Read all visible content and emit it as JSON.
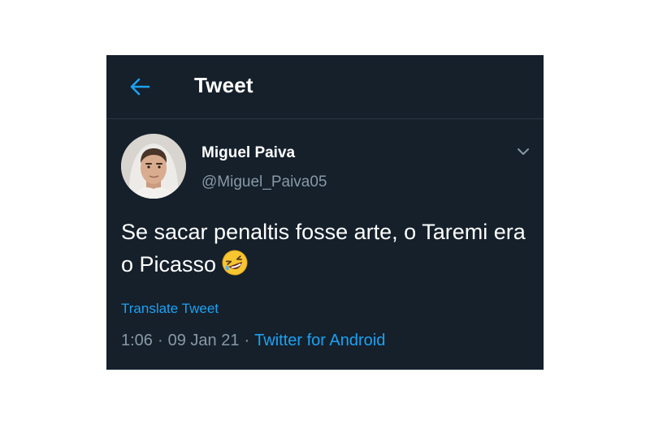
{
  "header": {
    "back_icon": "arrow-left-icon",
    "title": "Tweet"
  },
  "tweet": {
    "author": {
      "display_name": "Miguel Paiva",
      "handle": "@Miguel_Paiva05",
      "avatar_icon": "profile-photo"
    },
    "menu_icon": "chevron-down-icon",
    "text": "Se sacar penaltis fosse arte, o Taremi era o Picasso",
    "emoji_icon": "rolling-laughing-emoji-icon",
    "translate_label": "Translate Tweet",
    "time": "1:06",
    "date": "09 Jan 21",
    "separator": "·",
    "source": "Twitter for Android"
  },
  "colors": {
    "background": "#15202b",
    "accent": "#1da1f2",
    "muted": "#8899a6",
    "text": "#ffffff"
  }
}
